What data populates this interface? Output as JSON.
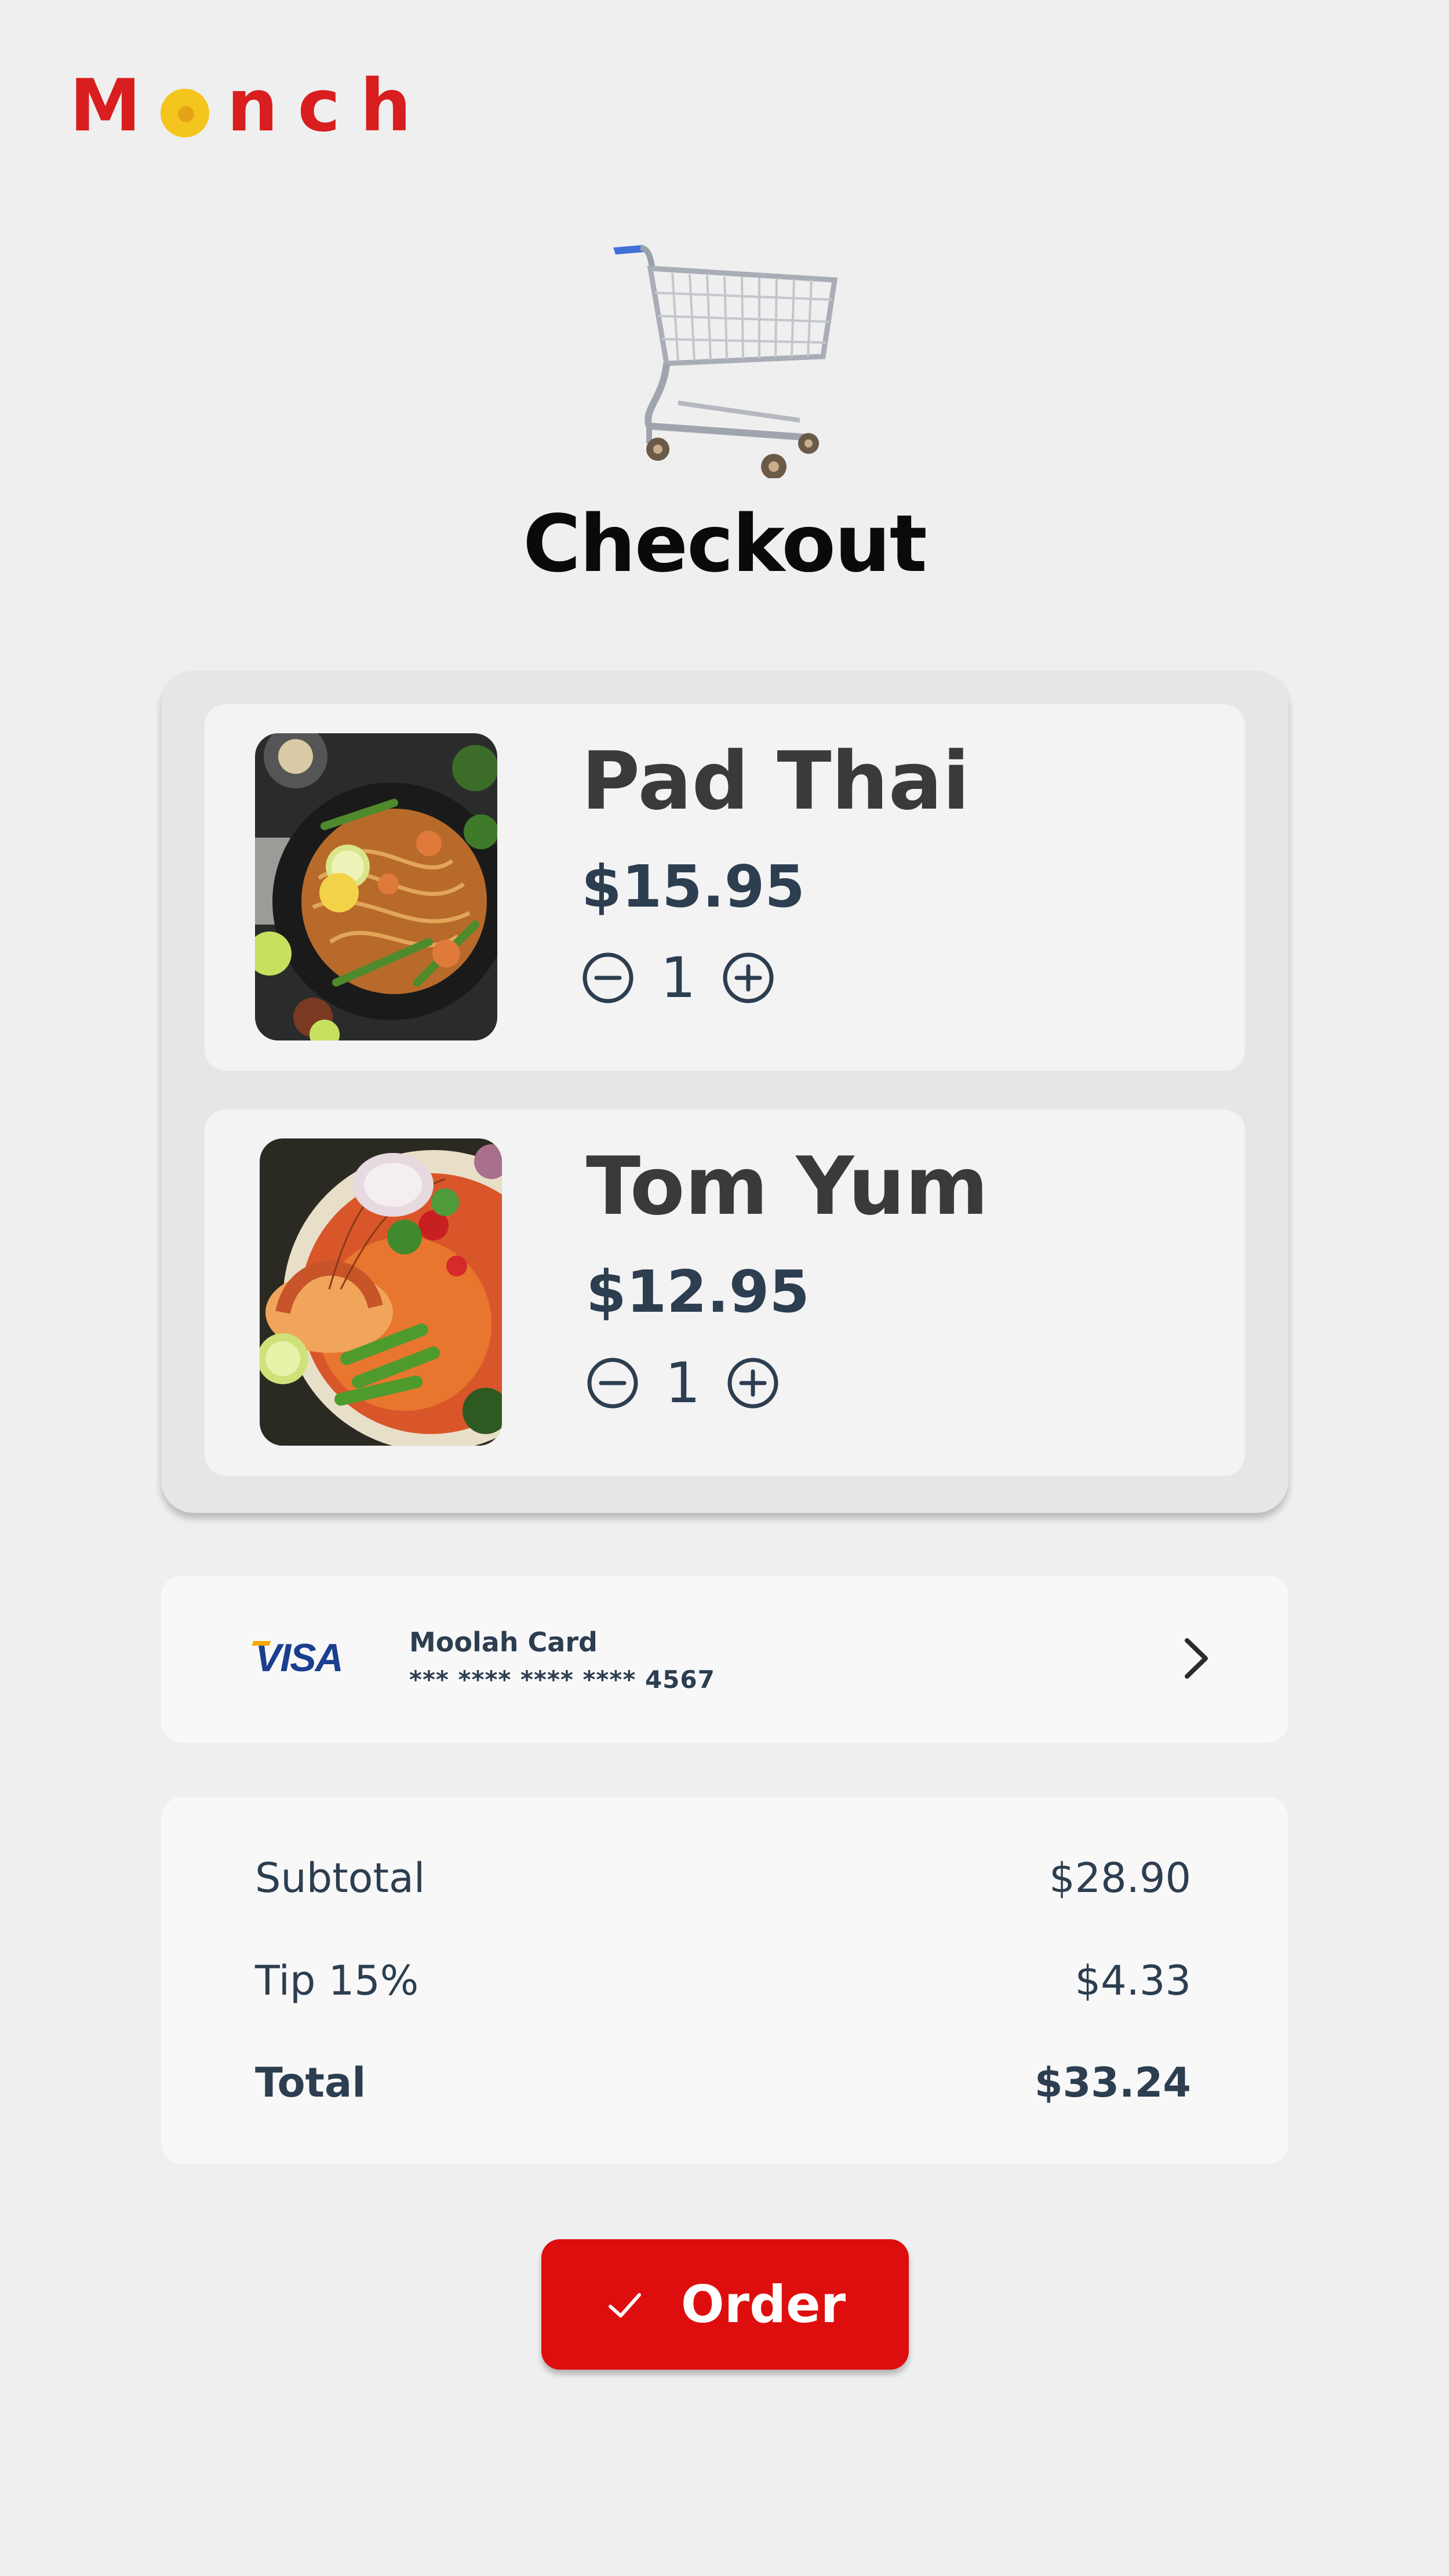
{
  "app": {
    "logo_text": "Monch",
    "brand_color": "#d81e1e",
    "accent_yellow": "#f4c51d"
  },
  "page": {
    "title": "Checkout",
    "header_icon": "shopping-cart-icon"
  },
  "cart": {
    "items": [
      {
        "name": "Pad Thai",
        "price": "$15.95",
        "quantity": "1",
        "image": "pad-thai-photo"
      },
      {
        "name": "Tom Yum",
        "price": "$12.95",
        "quantity": "1",
        "image": "tom-yum-photo"
      }
    ]
  },
  "payment": {
    "brand": "VISA",
    "card_name": "Moolah Card",
    "card_number": "*** **** **** **** 4567",
    "action_icon": "chevron-right-icon"
  },
  "summary": {
    "subtotal_label": "Subtotal",
    "subtotal_value": "$28.90",
    "tip_label": "Tip 15%",
    "tip_value": "$4.33",
    "total_label": "Total",
    "total_value": "$33.24"
  },
  "order_button": {
    "label": "Order",
    "icon": "check-icon",
    "color": "#de0e0e"
  }
}
